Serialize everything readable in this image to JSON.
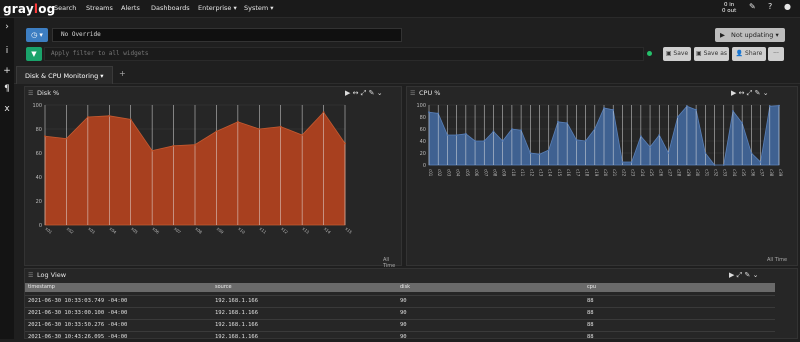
{
  "app": {
    "logo_prefix": "gray",
    "logo_o": "l",
    "logo_suffix": "og"
  },
  "nav": {
    "items": [
      "Search",
      "Streams",
      "Alerts",
      "Dashboards",
      "Enterprise ▾",
      "System ▾"
    ],
    "in_label": "0 in",
    "out_label": "0 out"
  },
  "toolbar": {
    "override_value": "No Override",
    "filter_placeholder": "Apply filter to all widgets",
    "not_updating_label": "Not updating",
    "save_label": "Save",
    "save_as_label": "Save as",
    "share_label": "Share",
    "more_label": "···"
  },
  "tabs": [
    {
      "label": "Disk & CPU Monitoring ▾"
    }
  ],
  "widgets": {
    "disk": {
      "title": "Disk %",
      "time": "All Time"
    },
    "cpu": {
      "title": "CPU %",
      "time": "All Time"
    },
    "log": {
      "title": "Log View"
    }
  },
  "colors": {
    "disk_fill": "#a8401f",
    "cpu_fill": "#3f6191",
    "brand_red": "#ff3b3b"
  },
  "chart_data": [
    {
      "type": "area",
      "title": "Disk %",
      "ylim": [
        0,
        100
      ],
      "yticks": [
        0,
        20,
        40,
        60,
        80,
        100
      ],
      "x": [
        "x01",
        "x02",
        "x03",
        "x04",
        "x05",
        "x06",
        "x07",
        "x08",
        "x09",
        "x10",
        "x11",
        "x12",
        "x13",
        "x14",
        "x15"
      ],
      "series": [
        {
          "values": [
            74,
            72,
            90,
            91,
            88,
            62,
            66,
            67,
            78,
            86,
            80,
            82,
            75,
            94,
            68
          ]
        }
      ]
    },
    {
      "type": "area",
      "title": "CPU %",
      "ylim": [
        0,
        100
      ],
      "yticks": [
        0,
        20,
        40,
        60,
        80,
        100
      ],
      "x": [
        "c01",
        "c02",
        "c03",
        "c04",
        "c05",
        "c06",
        "c07",
        "c08",
        "c09",
        "c10",
        "c11",
        "c12",
        "c13",
        "c14",
        "c15",
        "c16",
        "c17",
        "c18",
        "c19",
        "c20",
        "c21",
        "c22",
        "c23",
        "c24",
        "c25",
        "c26",
        "c27",
        "c28",
        "c29",
        "c30",
        "c31",
        "c32",
        "c33",
        "c34",
        "c35",
        "c36",
        "c37",
        "c38",
        "c39"
      ],
      "series": [
        {
          "values": [
            88,
            86,
            50,
            50,
            52,
            40,
            40,
            56,
            40,
            60,
            58,
            20,
            18,
            25,
            72,
            70,
            42,
            40,
            60,
            95,
            92,
            5,
            5,
            48,
            30,
            50,
            20,
            80,
            98,
            92,
            20,
            0,
            0,
            90,
            70,
            20,
            5,
            98,
            99
          ]
        }
      ]
    }
  ],
  "log_view": {
    "columns": [
      "timestamp",
      "source",
      "disk",
      "cpu"
    ],
    "rows": [
      [
        "2021-06-30 10:33:03.749 -04:00",
        "192.168.1.166",
        "90",
        "88"
      ],
      [
        "2021-06-30 10:33:00.100 -04:00",
        "192.168.1.166",
        "90",
        "88"
      ],
      [
        "2021-06-30 10:33:50.276 -04:00",
        "192.168.1.166",
        "90",
        "88"
      ],
      [
        "2021-06-30 10:43:26.095 -04:00",
        "192.168.1.166",
        "90",
        "88"
      ]
    ]
  }
}
